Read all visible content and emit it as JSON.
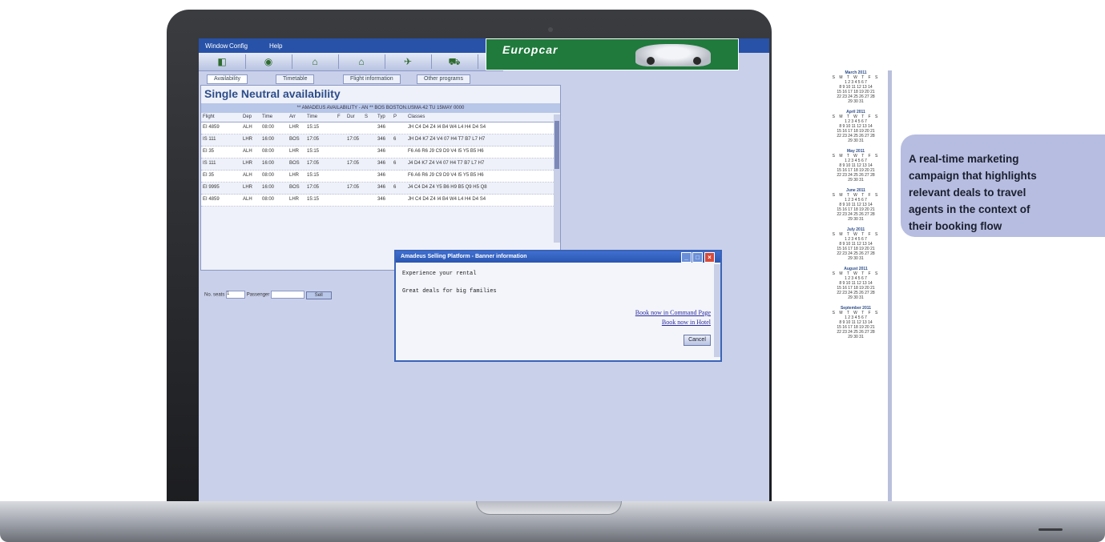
{
  "menubar": {
    "items": [
      "Window",
      "Config",
      "Help"
    ]
  },
  "banner": {
    "text": "Europcar"
  },
  "tabs": [
    "Availability",
    "Timetable",
    "Flight information",
    "Other programs"
  ],
  "availability": {
    "title": "Single Neutral availability",
    "header": "** AMADEUS AVAILABILITY - AN ** BOS BOSTON.USMA 42 TU 15MAY 0000",
    "columns": [
      "Flight",
      "Dep",
      "Time",
      "Arr",
      "Time",
      "F",
      "Dur",
      "S",
      "Typ",
      "P",
      "Classes"
    ],
    "rows": [
      [
        "EI 4859",
        "ALH",
        "08:00",
        "LHR",
        "15:15",
        "",
        "",
        "",
        "346",
        "",
        "JH C4 D4 Z4 I4 B4 W4 L4 H4 D4 S4"
      ],
      [
        "IS 111",
        "LHR",
        "16:00",
        "BOS",
        "17:05",
        "",
        "17:05",
        "",
        "346",
        "6",
        "JH D4 K7 Z4 V4 07 H4 T7 B7 L7 H7"
      ],
      [
        "EI 35",
        "ALH",
        "08:00",
        "LHR",
        "15:15",
        "",
        "",
        "",
        "346",
        "",
        "F6 A6 R6 J9 C9 D9 V4 I5 Y5 B5 H6"
      ],
      [
        "IS 111",
        "LHR",
        "16:00",
        "BOS",
        "17:05",
        "",
        "17:05",
        "",
        "346",
        "6",
        "J4 D4 K7 Z4 V4 07 H4 T7 B7 L7 H7"
      ],
      [
        "EI 35",
        "ALH",
        "08:00",
        "LHR",
        "15:15",
        "",
        "",
        "",
        "346",
        "",
        "F6 A6 R6 J9 C9 D9 V4 I5 Y5 B5 H6"
      ],
      [
        "EI 9995",
        "LHR",
        "16:00",
        "BOS",
        "17:05",
        "",
        "17:05",
        "",
        "346",
        "6",
        "J4 C4 D4 Z4 Y5 B6 H9 B5 Q9 H5 Q8"
      ],
      [
        "EI 4859",
        "ALH",
        "08:00",
        "LHR",
        "15:15",
        "",
        "",
        "",
        "346",
        "",
        "JH C4 D4 Z4 I4 B4 W4 L4 H4 D4 S4"
      ]
    ],
    "footer": {
      "seats_label": "No. seats",
      "seats_value": "1",
      "passenger_label": "Passenger",
      "sell_label": "Sell"
    }
  },
  "popup": {
    "title": "Amadeus Selling Platform - Banner information",
    "line1": "Experience your rental",
    "line2": "Great deals for big families",
    "link1": "Book now in Command Page",
    "link2": "Book now in Hotel",
    "cancel": "Cancel"
  },
  "calendar": [
    {
      "month": "March 2011",
      "days": "S M T W T F S"
    },
    {
      "month": "April 2011",
      "days": "S M T W T F S"
    },
    {
      "month": "May 2011",
      "days": "S M T W T F S"
    },
    {
      "month": "June 2011",
      "days": "S M T W T F S"
    },
    {
      "month": "July 2011",
      "days": "S M T W T F S"
    },
    {
      "month": "August 2011",
      "days": "S M T W T F S"
    },
    {
      "month": "September 2011",
      "days": "S M T W T F S"
    }
  ],
  "callout": {
    "text": "A real-time marketing\ncampaign that highlights\nrelevant deals to travel\nagents in the context of\ntheir booking flow"
  }
}
